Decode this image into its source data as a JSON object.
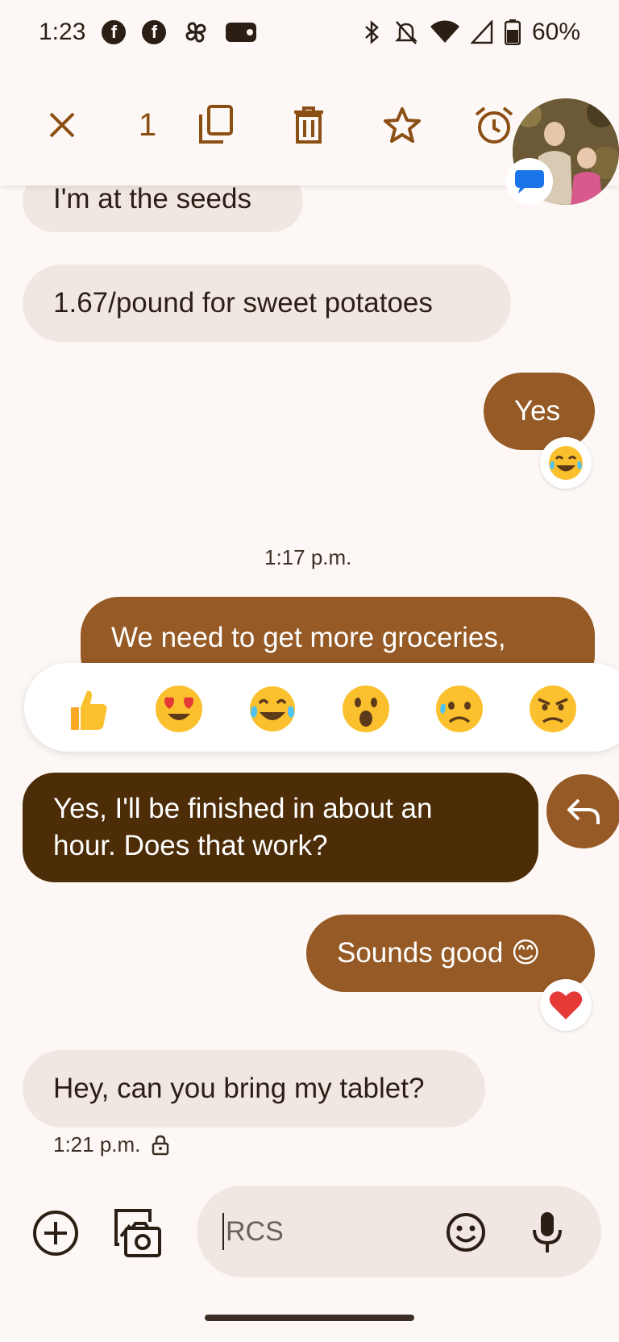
{
  "status_bar": {
    "time": "1:23",
    "battery": "60%"
  },
  "action_bar": {
    "selected_count": "1",
    "icons": [
      "close-icon",
      "copy-icon",
      "delete-icon",
      "star-icon",
      "alarm-icon"
    ]
  },
  "messages": [
    {
      "text": "I'm at the seeds",
      "direction": "incoming"
    },
    {
      "text": "1.67/pound for sweet potatoes",
      "direction": "incoming"
    },
    {
      "text": "Yes",
      "direction": "outgoing",
      "reaction": "😂"
    },
    {
      "text": "1:17 p.m.",
      "type": "timestamp"
    },
    {
      "text": "We need to get more groceries,",
      "direction": "outgoing"
    },
    {
      "text_line1": "Yes, I'll be finished in about an",
      "text_line2": "hour. Does that work?",
      "direction": "incoming",
      "selected": true
    },
    {
      "text": "Sounds good 😊",
      "direction": "outgoing",
      "reaction": "❤️"
    },
    {
      "text": "Hey, can you bring my tablet?",
      "direction": "incoming"
    }
  ],
  "last_message_meta": {
    "time": "1:21 p.m."
  },
  "emoji_picker": [
    "thumbs-up",
    "heart-eyes",
    "tears-of-joy",
    "surprised",
    "sad-sweat",
    "angry"
  ],
  "compose": {
    "placeholder": "RCS"
  },
  "colors": {
    "outgoing_bubble": "#955a25",
    "incoming_bubble": "#f1e7e2",
    "selected_bubble": "#4d2d07",
    "accent": "#8b4f14"
  }
}
